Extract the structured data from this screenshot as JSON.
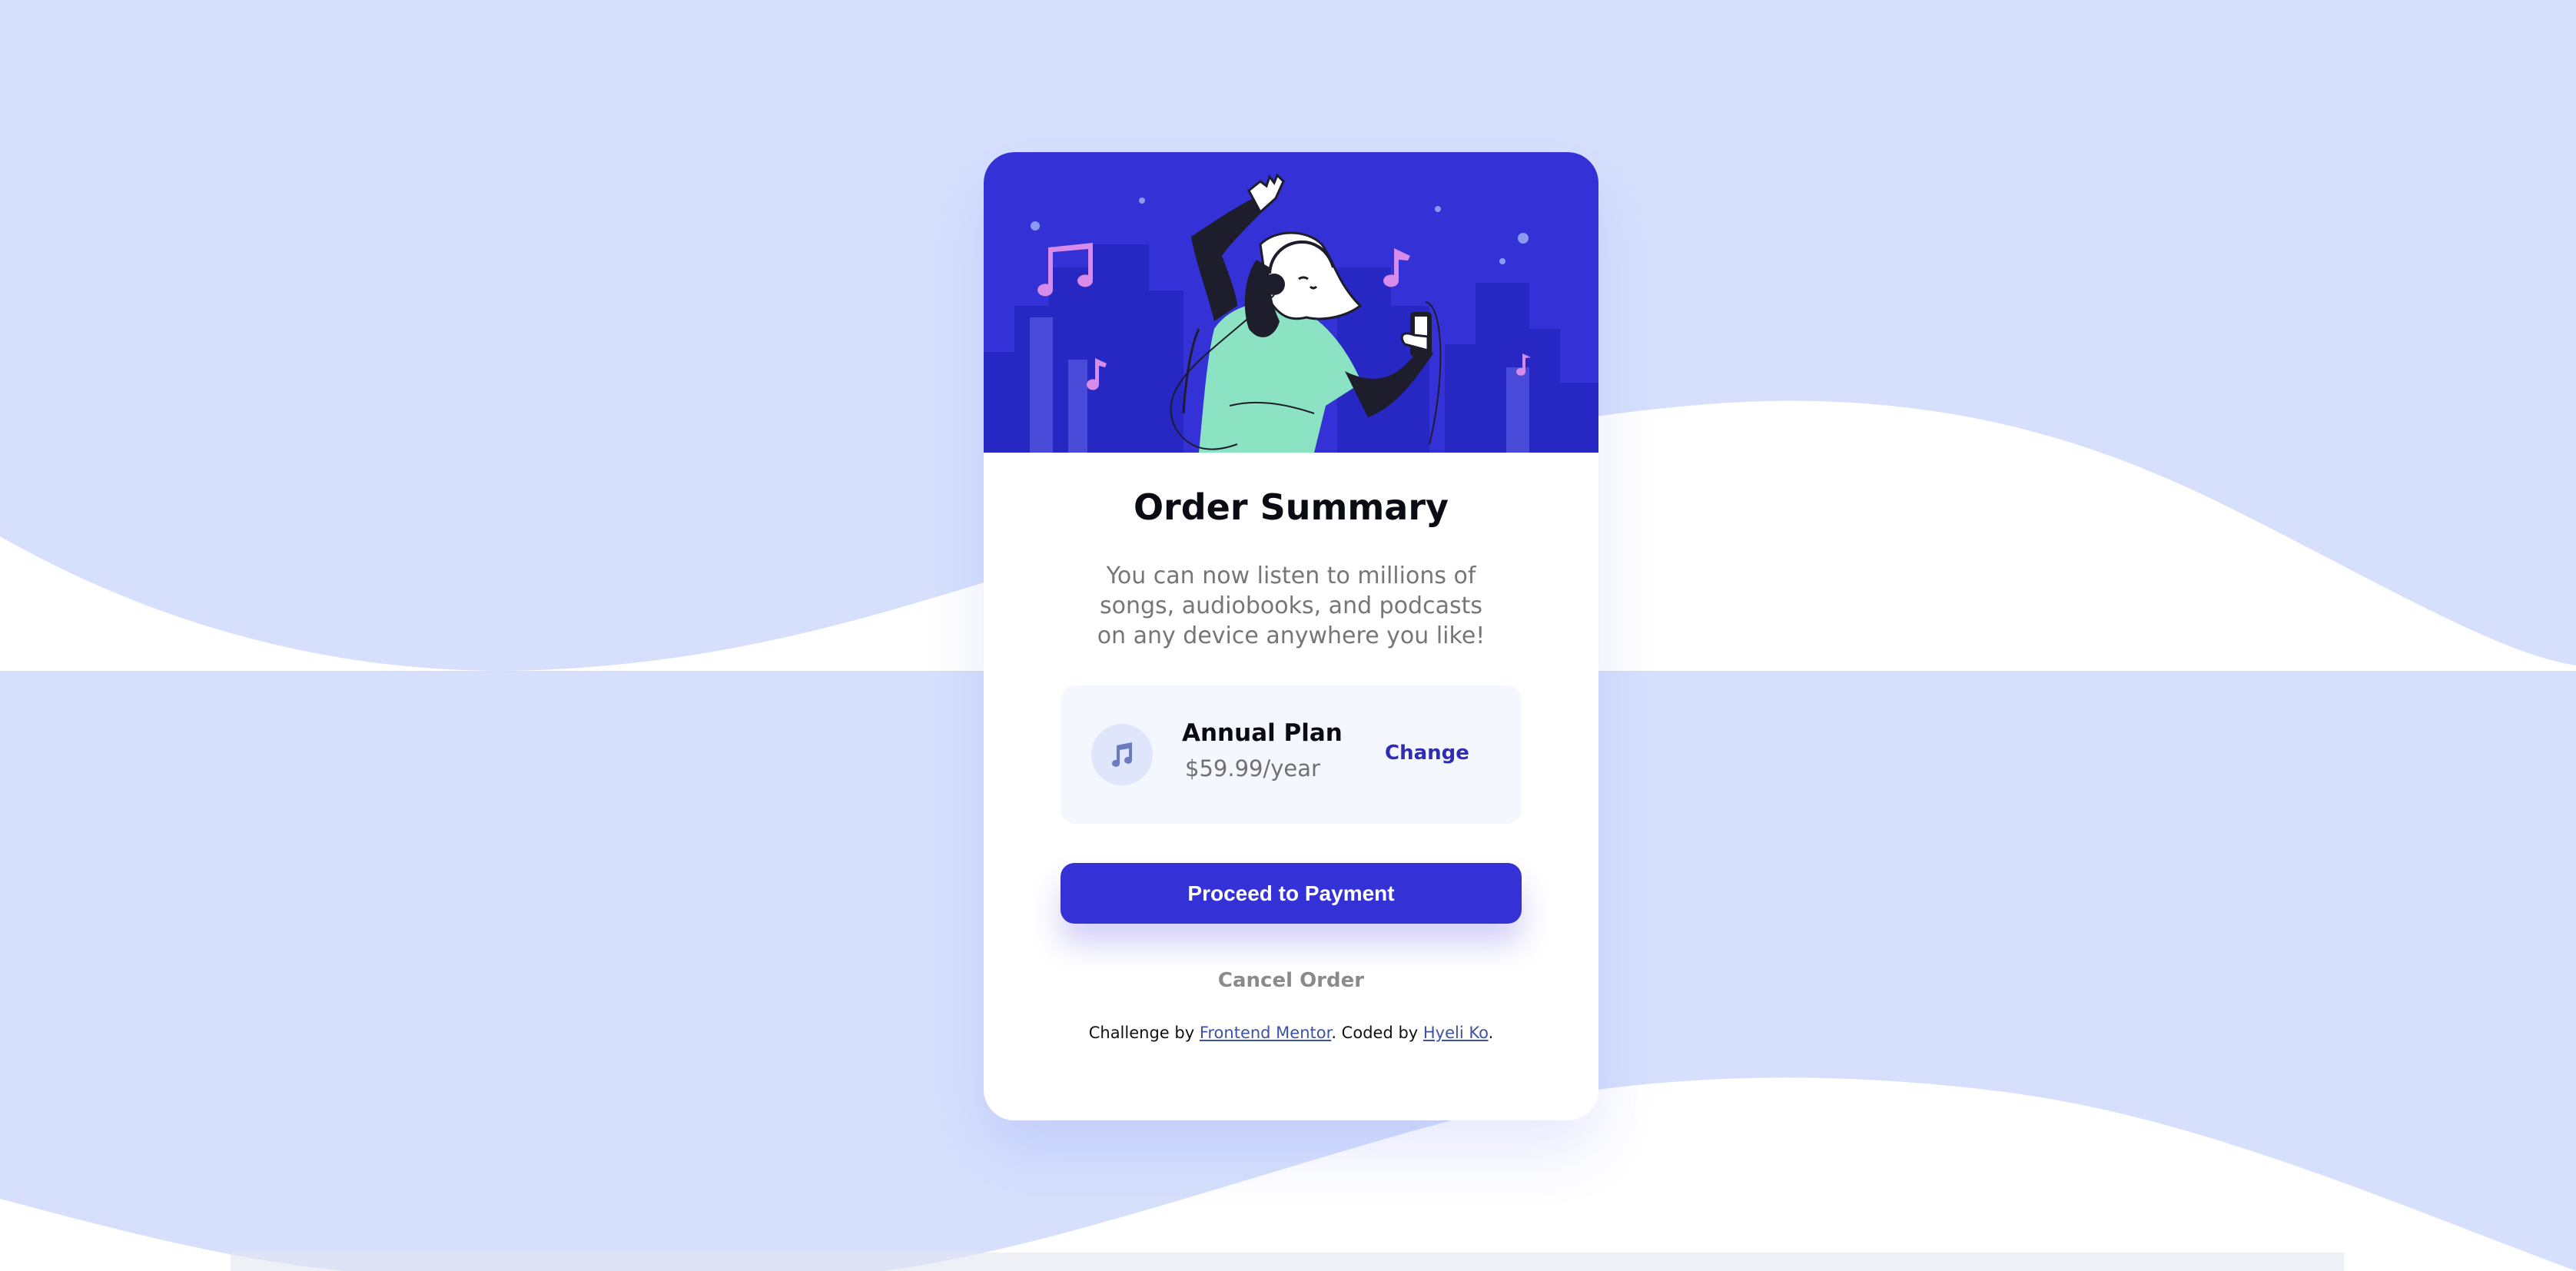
{
  "colors": {
    "page_background": "#d6e0fc",
    "wave": "#ffffff",
    "hero_background": "#3432d6",
    "accent": "#3432d6",
    "plan_box": "#f5f7ff",
    "link": "#3e52a3"
  },
  "hero": {
    "illustration": "person dancing with headphones and phone, city skyline, music notes"
  },
  "card": {
    "title": "Order Summary",
    "description": "You can now listen to millions of songs, audiobooks, and podcasts on any device anywhere you like!",
    "plan": {
      "icon": "music-note-icon",
      "name": "Annual Plan",
      "price": "$59.99/year",
      "change_label": "Change"
    },
    "proceed_label": "Proceed to Payment",
    "cancel_label": "Cancel Order",
    "attribution": {
      "prefix": "Challenge by ",
      "challenge_link": "Frontend Mentor",
      "middle": ". Coded by ",
      "author_link": "Hyeli Ko",
      "suffix": "."
    }
  }
}
